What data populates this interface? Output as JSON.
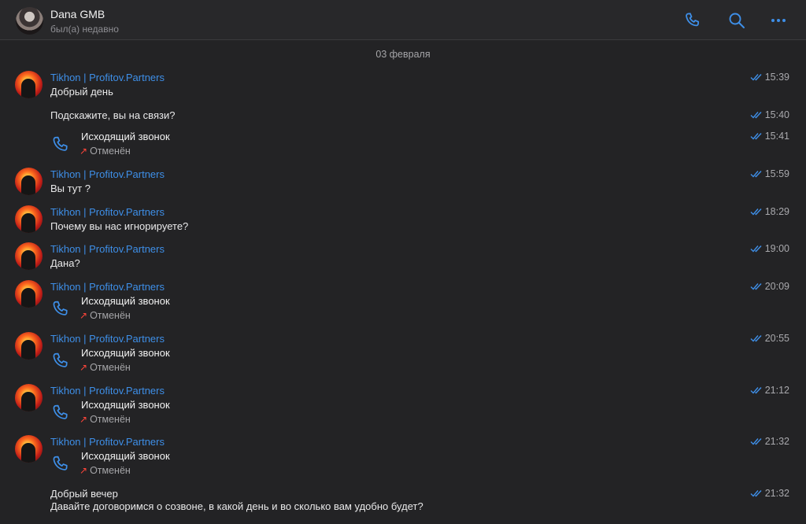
{
  "header": {
    "contact_name": "Dana GMB",
    "status": "был(а) недавно"
  },
  "date_separator": "03 февраля",
  "sender_name": "Tikhon | Profitov.Partners",
  "messages": [
    {
      "text": "Добрый день",
      "time": "15:39"
    },
    {
      "text": "Подскажите, вы на связи?",
      "time": "15:40"
    },
    {
      "call_title": "Исходящий звонок",
      "call_status": "Отменён",
      "time": "15:41"
    },
    {
      "text": "Вы тут ?",
      "time": "15:59"
    },
    {
      "text": "Почему вы нас игнорируете?",
      "time": "18:29"
    },
    {
      "text": "Дана?",
      "time": "19:00"
    },
    {
      "call_title": "Исходящий звонок",
      "call_status": "Отменён",
      "time": "20:09"
    },
    {
      "call_title": "Исходящий звонок",
      "call_status": "Отменён",
      "time": "20:55"
    },
    {
      "call_title": "Исходящий звонок",
      "call_status": "Отменён",
      "time": "21:12"
    },
    {
      "call_title": "Исходящий звонок",
      "call_status": "Отменён",
      "time": "21:32"
    },
    {
      "text": "Добрый вечер",
      "text2": "Давайте договоримся о созвоне, в какой день и во сколько вам удобно будет?",
      "time": "21:32"
    }
  ],
  "colors": {
    "accent": "#3e8fe8",
    "cancel": "#ff453a",
    "background": "#232325"
  }
}
